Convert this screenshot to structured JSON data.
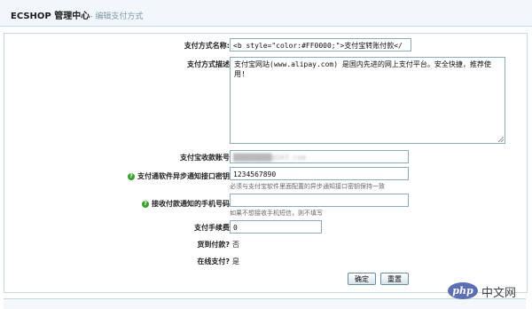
{
  "header": {
    "brand": "ECSHOP 管理中心",
    "breadcrumb": "- 编辑支付方式"
  },
  "form": {
    "pay_name": {
      "label": "支付方式名称:",
      "value": "<b style=\"color:#FF0000;\">支付宝转账付款</"
    },
    "pay_desc": {
      "label": "支付方式描述",
      "value": "支付宝网站(www.alipay.com) 是国内先进的网上支付平台。安全快捷，推荐使用!"
    },
    "account": {
      "label": "支付宝收款账号",
      "value": "█████████@163.com"
    },
    "key": {
      "label": "支付通软件异步通知接口密钥",
      "value": "1234567890",
      "help": "必须与支付宝软件里面配置的异步通知接口密钥保持一致"
    },
    "mobile": {
      "label": "接收付款通知的手机号码",
      "value": "",
      "help": "如果不想接收手机短信，则不填写"
    },
    "fee": {
      "label": "支付手续费",
      "value": "0"
    },
    "cod": {
      "label": "货到付款?",
      "value": "否"
    },
    "online": {
      "label": "在线支付?",
      "value": "是"
    }
  },
  "buttons": {
    "confirm": "确定",
    "reset": "重置"
  },
  "watermark": {
    "text": "中文网",
    "logo": "php"
  }
}
